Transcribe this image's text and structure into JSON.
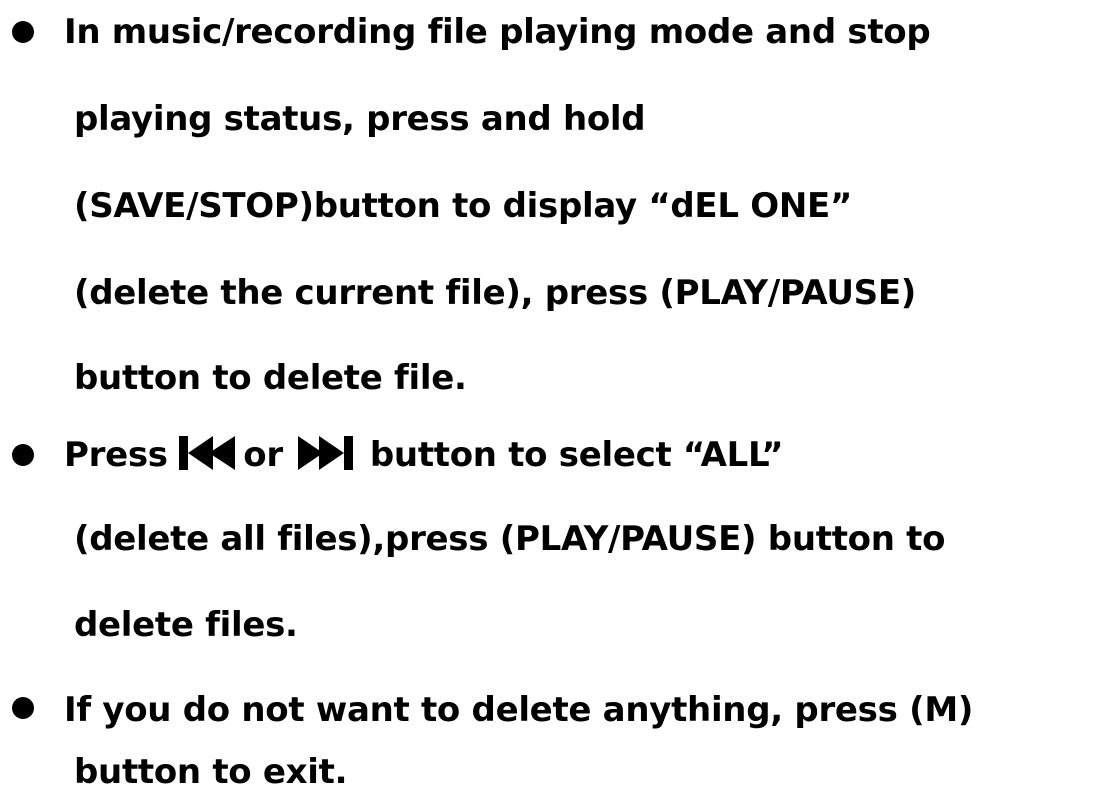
{
  "bullets": [
    {
      "lines": [
        "In music/recording file playing mode and stop",
        "playing status, press and hold",
        "(SAVE/STOP)button to display “dEL ONE”",
        "(delete the current file), press (PLAY/PAUSE)",
        "button to delete file."
      ]
    },
    {
      "first_line": {
        "prefix": "Press ",
        "middle": "or ",
        "suffix": " button to select   “ALL”"
      },
      "lines": [
        "(delete all files),press (PLAY/PAUSE) button to",
        "delete files."
      ]
    },
    {
      "lines": [
        "If you do not want to delete anything, press (M)",
        "button to exit."
      ]
    }
  ],
  "icons": {
    "previous": "skip-previous-icon",
    "next": "skip-next-icon"
  }
}
